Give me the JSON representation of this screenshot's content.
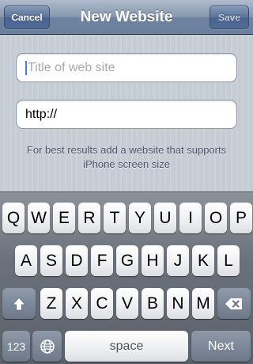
{
  "navbar": {
    "cancel_label": "Cancel",
    "title": "New Website",
    "save_label": "Save"
  },
  "form": {
    "title_placeholder": "Title of web site",
    "url_value": "http://",
    "hint": "For best results add a website that supports iPhone screen size"
  },
  "keyboard": {
    "row1": [
      "Q",
      "W",
      "E",
      "R",
      "T",
      "Y",
      "U",
      "I",
      "O",
      "P"
    ],
    "row2": [
      "A",
      "S",
      "D",
      "F",
      "G",
      "H",
      "J",
      "K",
      "L"
    ],
    "row3": [
      "Z",
      "X",
      "C",
      "V",
      "B",
      "N",
      "M"
    ],
    "shift_icon": "shift-arrow-icon",
    "backspace_icon": "backspace-icon",
    "numbers_label": "123",
    "globe_icon": "globe-icon",
    "space_label": "space",
    "next_label": "Next"
  }
}
